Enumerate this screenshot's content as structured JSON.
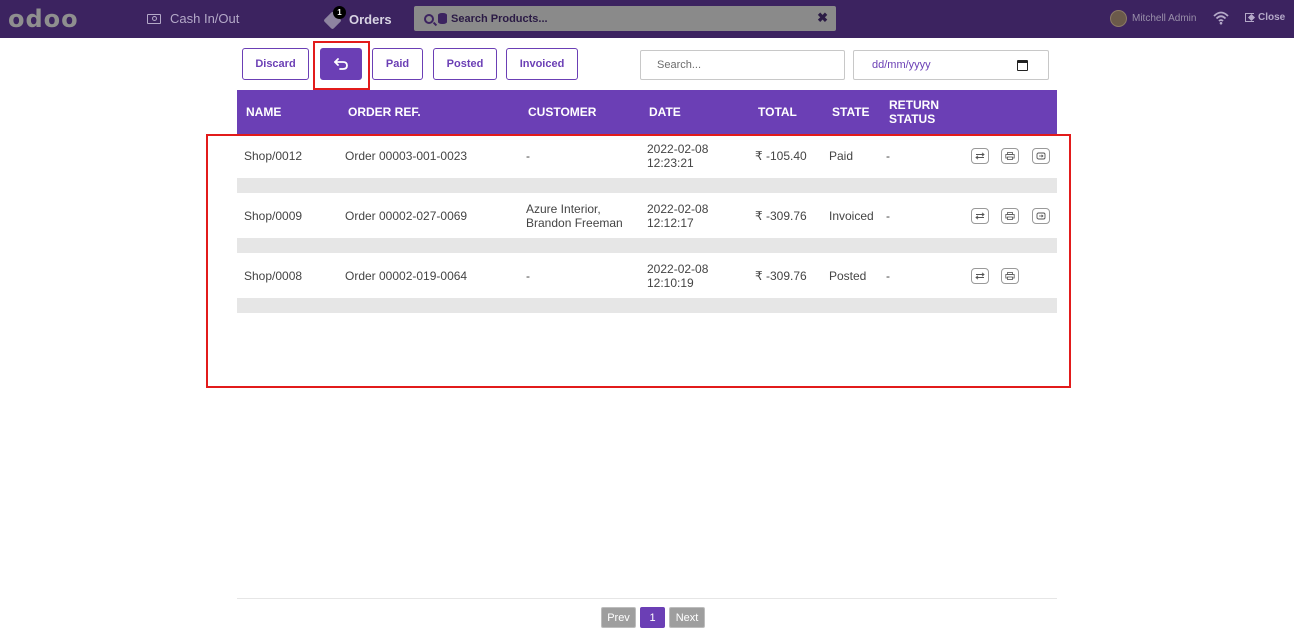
{
  "topbar": {
    "logo": "odoo",
    "cash_label": "Cash In/Out",
    "orders_label": "Orders",
    "orders_badge": "1",
    "product_search_placeholder": "Search Products...",
    "clear_symbol": "✖",
    "user_name": "Mitchell Admin",
    "close_label": "Close"
  },
  "toolbar": {
    "discard_label": "Discard",
    "paid_label": "Paid",
    "posted_label": "Posted",
    "invoiced_label": "Invoiced",
    "search_placeholder": "Search...",
    "date_placeholder": "dd/mm/yyyy"
  },
  "table": {
    "headers": [
      "NAME",
      "ORDER REF.",
      "CUSTOMER",
      "DATE",
      "TOTAL",
      "STATE",
      "RETURN STATUS"
    ],
    "rows": [
      {
        "name": "Shop/0012",
        "order_ref": "Order 00003-001-0023",
        "customer_line1": "-",
        "customer_line2": "",
        "date_line1": "2022-02-08",
        "date_line2": "12:23:21",
        "total": "₹ -105.40",
        "state": "Paid",
        "return_status": "-",
        "has_return": true
      },
      {
        "name": "Shop/0009",
        "order_ref": "Order 00002-027-0069",
        "customer_line1": "Azure Interior,",
        "customer_line2": "Brandon Freeman",
        "date_line1": "2022-02-08",
        "date_line2": "12:12:17",
        "total": "₹ -309.76",
        "state": "Invoiced",
        "return_status": "-",
        "has_return": true
      },
      {
        "name": "Shop/0008",
        "order_ref": "Order 00002-019-0064",
        "customer_line1": "-",
        "customer_line2": "",
        "date_line1": "2022-02-08",
        "date_line2": "12:10:19",
        "total": "₹ -309.76",
        "state": "Posted",
        "return_status": "-",
        "has_return": false
      }
    ]
  },
  "pagination": {
    "prev_label": "Prev",
    "current_page": "1",
    "next_label": "Next"
  },
  "colors": {
    "topbar": "#3c2360",
    "accent": "#6b3fb5",
    "highlight": "#e21b1b"
  }
}
